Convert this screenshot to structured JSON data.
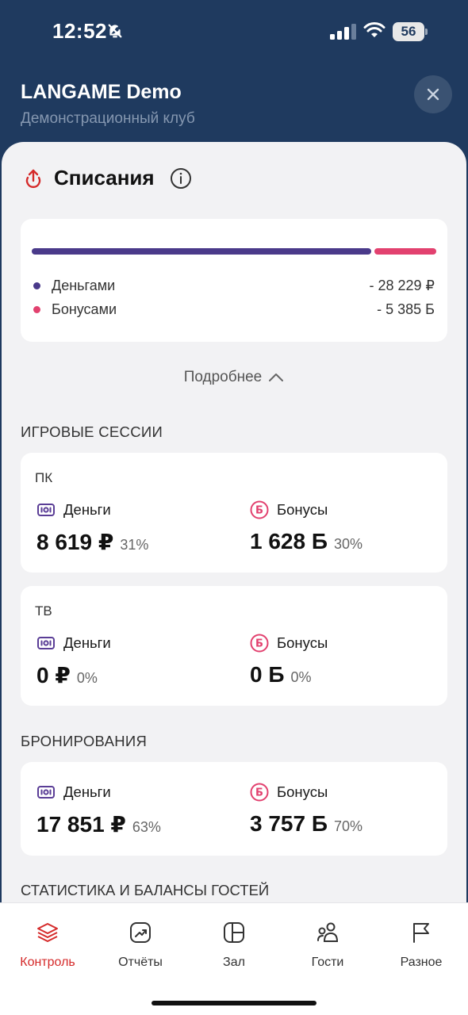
{
  "status_bar": {
    "time": "12:52",
    "battery": "56"
  },
  "header": {
    "title": "LANGAME Demo",
    "subtitle": "Демонстрационный клуб"
  },
  "writeoffs": {
    "title": "Списания",
    "money_share": 0.84,
    "legend": [
      {
        "label": "Деньгами",
        "value": "- 28 229 ₽",
        "color": "#4a3a8a"
      },
      {
        "label": "Бонусами",
        "value": "- 5 385 Б",
        "color": "#e2416f"
      }
    ],
    "more_label": "Подробнее"
  },
  "game_sessions": {
    "label": "ИГРОВЫЕ СЕССИИ",
    "devices": [
      {
        "name": "ПК",
        "money_label": "Деньги",
        "money_amount": "8 619 ₽",
        "money_pct": "31%",
        "bonus_label": "Бонусы",
        "bonus_amount": "1 628 Б",
        "bonus_pct": "30%"
      },
      {
        "name": "ТВ",
        "money_label": "Деньги",
        "money_amount": "0 ₽",
        "money_pct": "0%",
        "bonus_label": "Бонусы",
        "bonus_amount": "0 Б",
        "bonus_pct": "0%"
      }
    ]
  },
  "bookings": {
    "label": "БРОНИРОВАНИЯ",
    "money_label": "Деньги",
    "money_amount": "17 851 ₽",
    "money_pct": "63%",
    "bonus_label": "Бонусы",
    "bonus_amount": "3 757 Б",
    "bonus_pct": "70%"
  },
  "guest_stats": {
    "label": "СТАТИСТИКА И БАЛАНСЫ ГОСТЕЙ"
  },
  "tabs": [
    {
      "label": "Контроль",
      "icon": "layers-icon",
      "active": true
    },
    {
      "label": "Отчёты",
      "icon": "chart-up-icon",
      "active": false
    },
    {
      "label": "Зал",
      "icon": "floor-plan-icon",
      "active": false
    },
    {
      "label": "Гости",
      "icon": "users-icon",
      "active": false
    },
    {
      "label": "Разное",
      "icon": "flag-icon",
      "active": false
    }
  ],
  "colors": {
    "header_bg": "#1f3a5f",
    "accent_red": "#d52a2a",
    "money": "#4a3a8a",
    "bonus": "#e2416f"
  }
}
